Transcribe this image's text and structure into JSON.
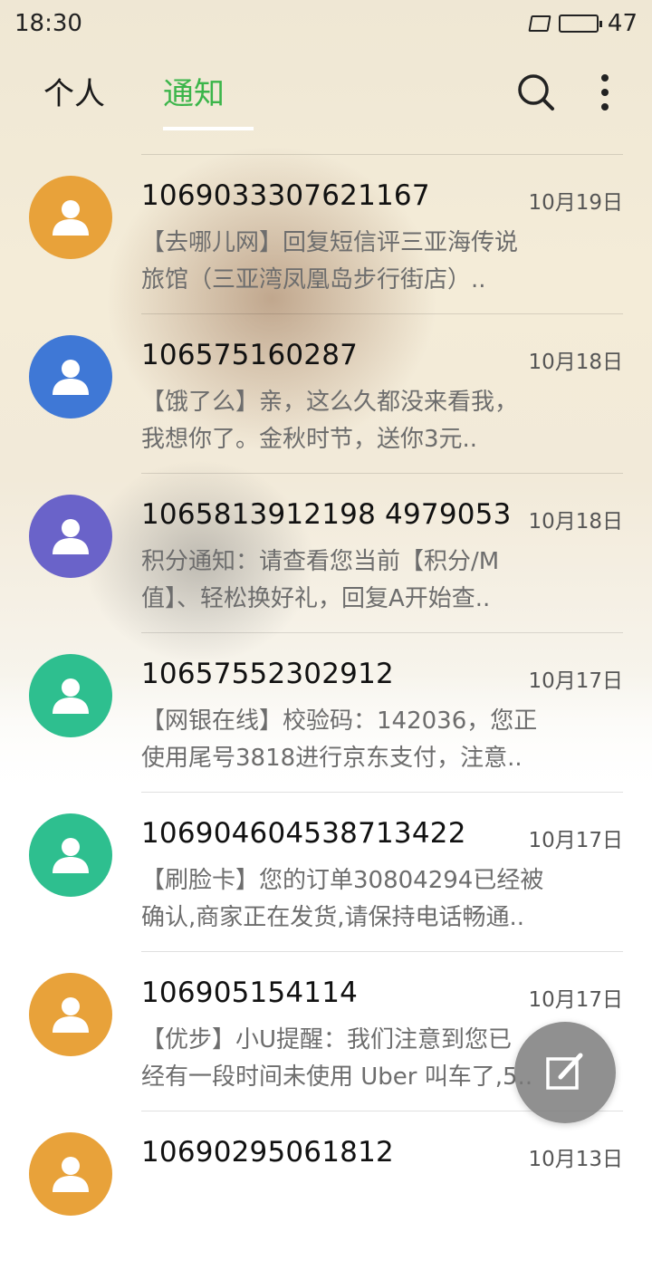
{
  "status_bar": {
    "time": "18:30",
    "battery_level": "47"
  },
  "tabs": [
    {
      "label": "个人",
      "selected": false
    },
    {
      "label": "通知",
      "selected": true
    }
  ],
  "accent_color": "#3bb54a",
  "messages": [
    {
      "sender": "1069033307621167",
      "date": "10月19日",
      "preview": "【去哪儿网】回复短信评三亚海传说\n旅馆（三亚湾凤凰岛步行街店）..",
      "avatar_color": "#e8a23a"
    },
    {
      "sender": "106575160287",
      "date": "10月18日",
      "preview": "【饿了么】亲，这么久都没来看我，\n我想你了。金秋时节，送你3元..",
      "avatar_color": "#3f78d6"
    },
    {
      "sender": "1065813912198 4979053",
      "date": "10月18日",
      "preview": "积分通知：请查看您当前【积分/M\n值】、轻松换好礼，回复A开始查..",
      "avatar_color": "#6a63c9"
    },
    {
      "sender": "10657552302912",
      "date": "10月17日",
      "preview": "【网银在线】校验码：142036，您正\n使用尾号3818进行京东支付，注意..",
      "avatar_color": "#2ebf8f"
    },
    {
      "sender": "106904604538713422",
      "date": "10月17日",
      "preview": "【刷脸卡】您的订单30804294已经被\n确认,商家正在发货,请保持电话畅通..",
      "avatar_color": "#2ebf8f"
    },
    {
      "sender": "106905154114",
      "date": "10月17日",
      "preview": "【优步】小U提醒：我们注意到您已\n经有一段时间未使用 Uber 叫车了,5..",
      "avatar_color": "#e8a23a"
    },
    {
      "sender": "10690295061812",
      "date": "10月13日",
      "preview": "",
      "avatar_color": "#e8a23a"
    }
  ],
  "icons": {
    "search": "search-icon",
    "more": "more-vert-icon",
    "compose": "compose-icon",
    "contact": "person-icon"
  }
}
